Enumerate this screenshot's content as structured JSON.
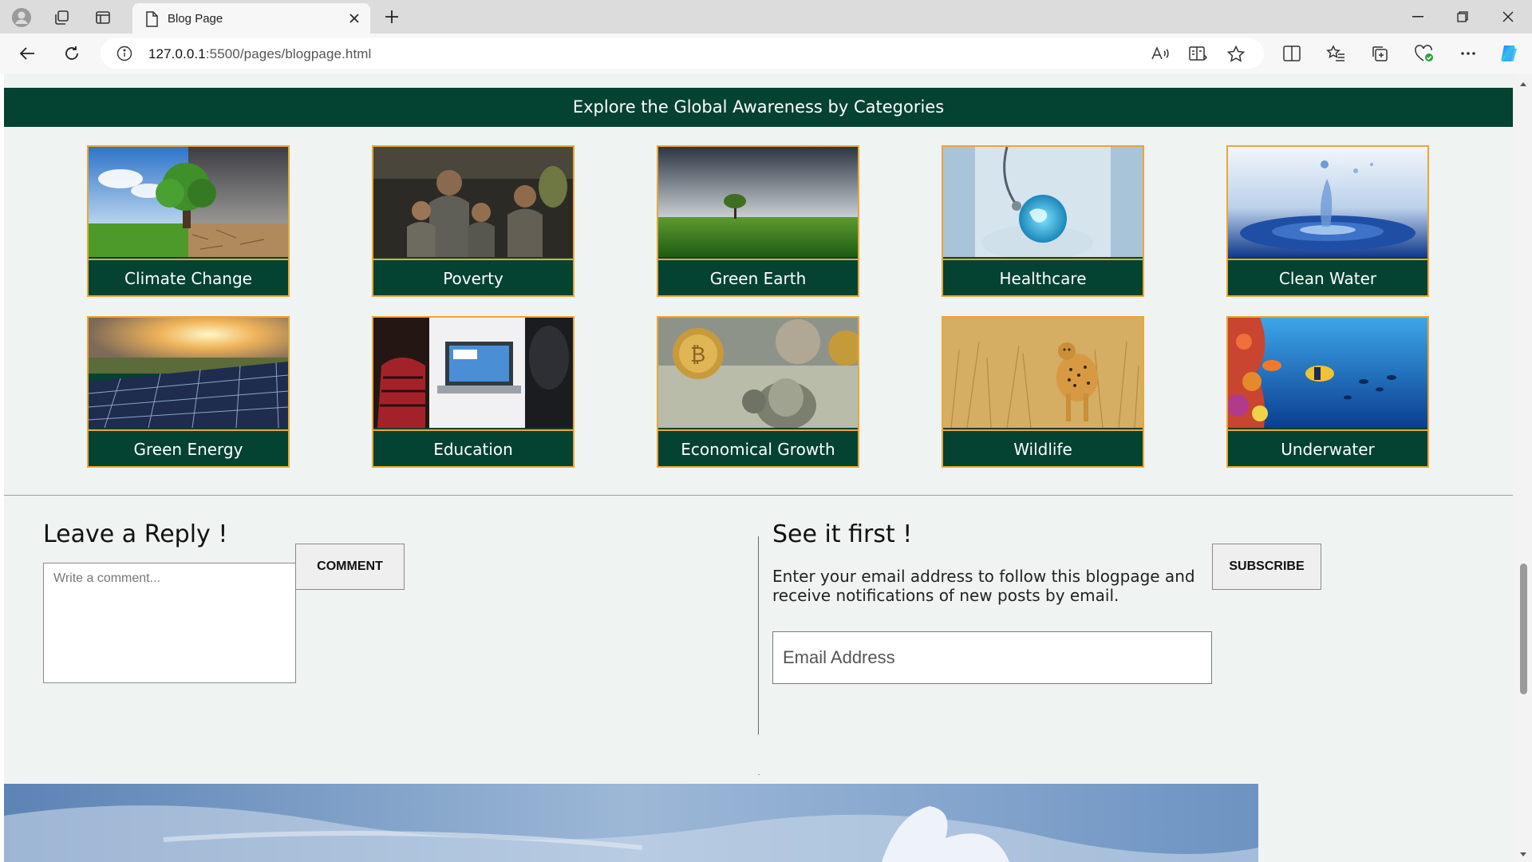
{
  "browser": {
    "tab_title": "Blog Page",
    "url_host": "127.0.0.1",
    "url_path": ":5500/pages/blogpage.html"
  },
  "page": {
    "categories_header": "Explore the Global Awareness by Categories",
    "categories": [
      {
        "label": "Climate Change",
        "image": "tree-split-weather"
      },
      {
        "label": "Poverty",
        "image": "children-portrait"
      },
      {
        "label": "Green Earth",
        "image": "tree-on-field"
      },
      {
        "label": "Healthcare",
        "image": "doctor-globe"
      },
      {
        "label": "Clean Water",
        "image": "water-splash"
      },
      {
        "label": "Green Energy",
        "image": "solar-panels-sunset"
      },
      {
        "label": "Education",
        "image": "student-laptop"
      },
      {
        "label": "Economical Growth",
        "image": "bitcoin-dollars"
      },
      {
        "label": "Wildlife",
        "image": "cheetah-grass"
      },
      {
        "label": "Underwater",
        "image": "coral-reef-fish"
      }
    ],
    "reply": {
      "title": "Leave a Reply !",
      "placeholder": "Write a comment...",
      "button": "COMMENT"
    },
    "subscribe": {
      "title": "See it first !",
      "text": "Enter your email address to follow this blogpage and receive notifications of new posts by email.",
      "placeholder": "Email Address",
      "button": "SUBSCRIBE"
    }
  },
  "colors": {
    "brand_green": "#044231",
    "accent_gold": "#e9a737",
    "page_bg": "#eff3f2"
  }
}
